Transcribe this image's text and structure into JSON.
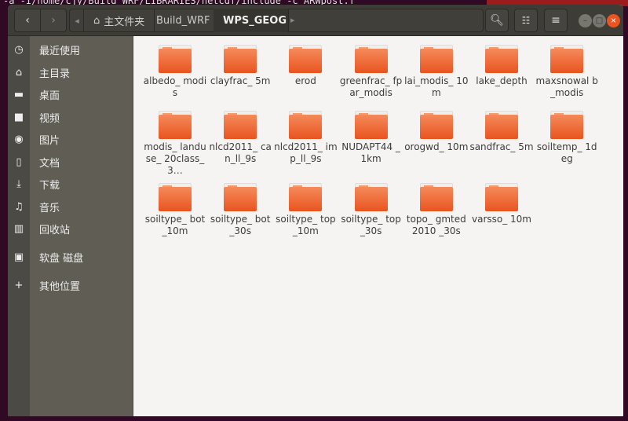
{
  "terminal": {
    "line": "-a  -I/home/cjy/Build_WRF/LIBRARIES/netcdf/include -c ARWpost.f"
  },
  "header": {
    "back": "‹",
    "forward": "›",
    "left_scroll": "◂",
    "right_scroll": "▸",
    "breadcrumbs": [
      {
        "label": "主文件夹",
        "icon": "home-icon"
      },
      {
        "label": "Build_WRF"
      },
      {
        "label": "WPS_GEOG",
        "active": true
      }
    ],
    "search": "search-icon",
    "view": "list-view-icon",
    "menu": "hamburger-menu-icon"
  },
  "sidebar": {
    "items": [
      {
        "label": "最近使用",
        "icon": "◷"
      },
      {
        "label": "主目录",
        "icon": "⌂"
      },
      {
        "label": "桌面",
        "icon": "▬"
      },
      {
        "label": "视频",
        "icon": "■"
      },
      {
        "label": "图片",
        "icon": "◉"
      },
      {
        "label": "文档",
        "icon": "▯"
      },
      {
        "label": "下载",
        "icon": "⤓"
      },
      {
        "label": "音乐",
        "icon": "♫"
      },
      {
        "label": "回收站",
        "icon": "▥"
      },
      {
        "label": "软盘 磁盘",
        "icon": "▣"
      },
      {
        "label": "其他位置",
        "icon": "+"
      }
    ]
  },
  "files": [
    "albedo_ modis",
    "clayfrac_ 5m",
    "erod",
    "greenfrac_ fpar_modis",
    "lai_modis_ 10m",
    "lake_depth",
    "maxsnowal b_modis",
    "modis_ landuse_ 20class_3…",
    "nlcd2011_ can_ll_9s",
    "nlcd2011_ imp_ll_9s",
    "NUDAPT44 _1km",
    "orogwd_ 10m",
    "sandfrac_ 5m",
    "soiltemp_ 1deg",
    "soiltype_ bot_10m",
    "soiltype_ bot_30s",
    "soiltype_ top_10m",
    "soiltype_ top_30s",
    "topo_ gmted2010 _30s",
    "varsso_ 10m"
  ]
}
